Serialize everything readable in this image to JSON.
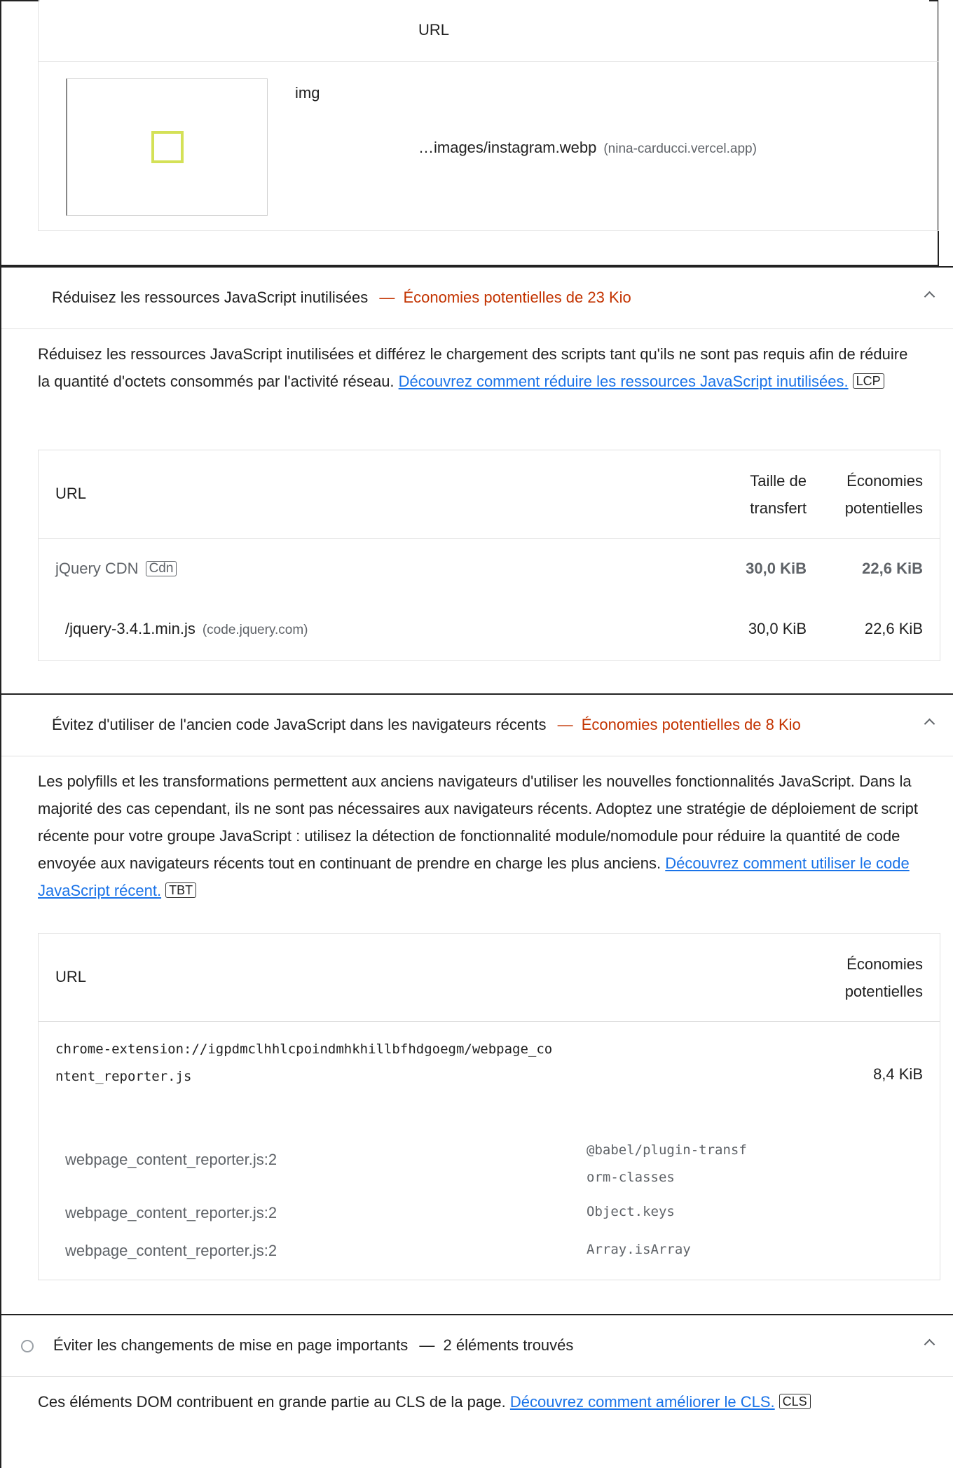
{
  "top_table": {
    "header_url": "URL",
    "row": {
      "node_type": "img",
      "url_path": "…images/instagram.webp",
      "url_host": "(nina-carducci.vercel.app)"
    }
  },
  "audit_unused_js": {
    "title": "Réduisez les ressources JavaScript inutilisées",
    "separator": "—",
    "savings": "Économies potentielles de 23 Kio",
    "description": "Réduisez les ressources JavaScript inutilisées et différez le chargement des scripts tant qu'ils ne sont pas requis afin de réduire la quantité d'octets consommés par l'activité réseau.",
    "link_text": "Découvrez comment réduire les ressources JavaScript inutilisées.",
    "metric_tag": "LCP",
    "table": {
      "col_url": "URL",
      "col_transfer": "Taille de transfert",
      "col_savings": "Économies potentielles",
      "group": {
        "label": "jQuery CDN",
        "tag": "Cdn",
        "transfer": "30,0 KiB",
        "savings": "22,6 KiB"
      },
      "row": {
        "path": "/jquery-3.4.1.min.js",
        "host": "(code.jquery.com)",
        "transfer": "30,0 KiB",
        "savings": "22,6 KiB"
      }
    }
  },
  "audit_legacy_js": {
    "title": "Évitez d'utiliser de l'ancien code JavaScript dans les navigateurs récents",
    "separator": "—",
    "savings": "Économies potentielles de 8 Kio",
    "description": "Les polyfills et les transformations permettent aux anciens navigateurs d'utiliser les nouvelles fonctionnalités JavaScript. Dans la majorité des cas cependant, ils ne sont pas nécessaires aux navigateurs récents. Adoptez une stratégie de déploiement de script récente pour votre groupe JavaScript : utilisez la détection de fonctionnalité module/nomodule pour réduire la quantité de code envoyée aux navigateurs récents tout en continuant de prendre en charge les plus anciens.",
    "link_text": "Découvrez comment utiliser le code JavaScript récent.",
    "metric_tag": "TBT",
    "table": {
      "col_url": "URL",
      "col_savings": "Économies potentielles",
      "main_row": {
        "url": "chrome-extension://igpdmclhhlcpoindmhkhillbfhdgoegm/webpage_content_reporter.js",
        "savings": "8,4 KiB"
      },
      "sub_rows": [
        {
          "location": "webpage_content_reporter.js:2",
          "signal": "@babel/plugin-transform-classes"
        },
        {
          "location": "webpage_content_reporter.js:2",
          "signal": "Object.keys"
        },
        {
          "location": "webpage_content_reporter.js:2",
          "signal": "Array.isArray"
        }
      ]
    }
  },
  "audit_cls": {
    "title": "Éviter les changements de mise en page importants",
    "separator": "—",
    "summary": "2 éléments trouvés",
    "description": "Ces éléments DOM contribuent en grande partie au CLS de la page.",
    "link_text": "Découvrez comment améliorer le CLS.",
    "metric_tag": "CLS"
  },
  "colors": {
    "savings_text": "#c33300",
    "link": "#1a73e8",
    "element_highlight": "#d4e157"
  }
}
